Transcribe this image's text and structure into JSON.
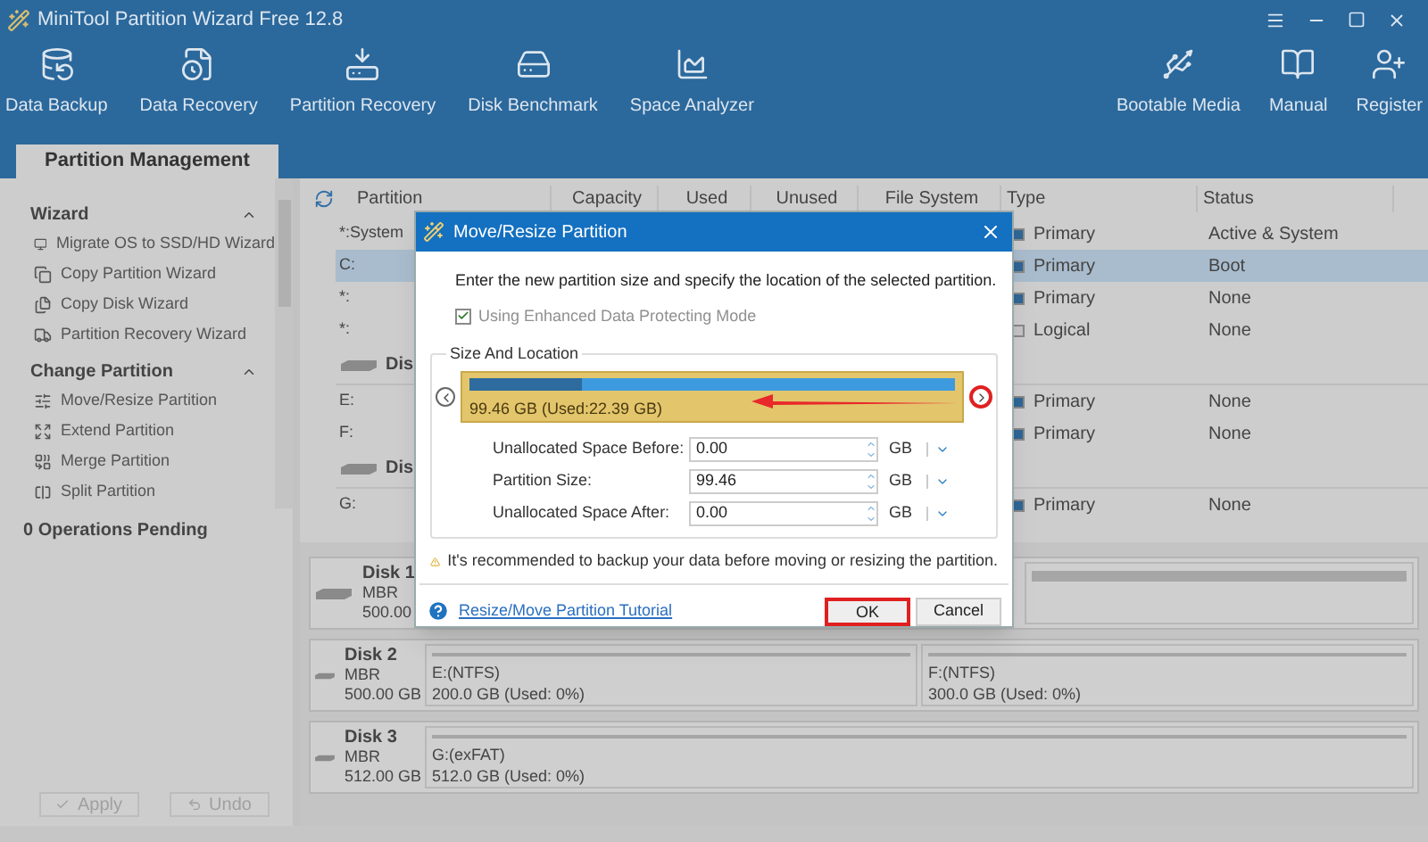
{
  "window": {
    "title": "MiniTool Partition Wizard Free 12.8"
  },
  "toolbar": {
    "left": [
      {
        "label": "Data Backup",
        "kind": "backup"
      },
      {
        "label": "Data Recovery",
        "kind": "recovery"
      },
      {
        "label": "Partition Recovery",
        "kind": "precovery"
      },
      {
        "label": "Disk Benchmark",
        "kind": "benchmark"
      },
      {
        "label": "Space Analyzer",
        "kind": "analyzer"
      }
    ],
    "right": [
      {
        "label": "Bootable Media",
        "kind": "usb"
      },
      {
        "label": "Manual",
        "kind": "book"
      },
      {
        "label": "Register",
        "kind": "user"
      }
    ]
  },
  "tabs": [
    {
      "label": "Partition Management",
      "selected": true
    }
  ],
  "sidebar": {
    "sections": [
      {
        "title": "Wizard",
        "expanded": true,
        "items": [
          {
            "label": "Migrate OS to SSD/HD Wizard",
            "kind": "migrate"
          },
          {
            "label": "Copy Partition Wizard",
            "kind": "copypart"
          },
          {
            "label": "Copy Disk Wizard",
            "kind": "copydisk"
          },
          {
            "label": "Partition Recovery Wizard",
            "kind": "precover"
          }
        ]
      },
      {
        "title": "Change Partition",
        "expanded": true,
        "items": [
          {
            "label": "Move/Resize Partition",
            "kind": "resize"
          },
          {
            "label": "Extend Partition",
            "kind": "extend"
          },
          {
            "label": "Merge Partition",
            "kind": "merge"
          },
          {
            "label": "Split Partition",
            "kind": "split"
          }
        ]
      }
    ],
    "pending": "0 Operations Pending",
    "buttons": [
      {
        "label": "Apply",
        "kind": "apply",
        "disabled": true
      },
      {
        "label": "Undo",
        "kind": "undo",
        "disabled": true
      }
    ]
  },
  "table": {
    "columns": [
      "Partition",
      "Capacity",
      "Used",
      "Unused",
      "File System",
      "Type",
      "Status"
    ],
    "rows": [
      {
        "kind": "partition",
        "partition": "*:System",
        "type": "Primary",
        "status": "Active & System",
        "color": "#2f6796",
        "selected": false
      },
      {
        "kind": "partition",
        "partition": "C:",
        "type": "Primary",
        "status": "Boot",
        "color": "#2f6796",
        "selected": true
      },
      {
        "kind": "partition",
        "partition": "*:",
        "type": "Primary",
        "status": "None",
        "color": "#2f6796",
        "selected": false
      },
      {
        "kind": "partition",
        "partition": "*:",
        "type": "Logical",
        "status": "None",
        "color": "#c4c4c4",
        "selected": false
      },
      {
        "kind": "disk",
        "partition": "Dis",
        "selected": false
      },
      {
        "kind": "partition",
        "partition": "E:",
        "type": "Primary",
        "status": "None",
        "color": "#2f6796",
        "selected": false
      },
      {
        "kind": "partition",
        "partition": "F:",
        "type": "Primary",
        "status": "None",
        "color": "#2f6796",
        "selected": false
      },
      {
        "kind": "disk",
        "partition": "Dis",
        "selected": false
      },
      {
        "kind": "partition",
        "partition": "G:",
        "type": "Primary",
        "status": "None",
        "color": "#2f6796",
        "selected": false
      }
    ]
  },
  "disk_map": [
    {
      "name": "Disk 1",
      "scheme": "MBR",
      "size": "500.00",
      "partitions": [
        {
          "kind": "hidden"
        }
      ]
    },
    {
      "name": "Disk 2",
      "scheme": "MBR",
      "size": "500.00 GB",
      "partitions": [
        {
          "label": "E:(NTFS)",
          "detail": "200.0 GB (Used: 0%)"
        },
        {
          "label": "F:(NTFS)",
          "detail": "300.0 GB (Used: 0%)"
        }
      ]
    },
    {
      "name": "Disk 3",
      "scheme": "MBR",
      "size": "512.00 GB",
      "partitions": [
        {
          "label": "G:(exFAT)",
          "detail": "512.0 GB (Used: 0%)"
        }
      ]
    }
  ],
  "dialog": {
    "title": "Move/Resize Partition",
    "instruction": "Enter the new partition size and specify the location of the selected partition.",
    "protect_mode": {
      "label": "Using Enhanced Data Protecting Mode",
      "checked": true,
      "disabled": true
    },
    "group_title": "Size And Location",
    "partition_bar": {
      "label": "99.46 GB (Used:22.39 GB)",
      "level": 0.23
    },
    "fields": [
      {
        "label": "Unallocated Space Before:",
        "value": "0.00",
        "unit": "GB"
      },
      {
        "label": "Partition Size:",
        "value": "99.46",
        "unit": "GB"
      },
      {
        "label": "Unallocated Space After:",
        "value": "0.00",
        "unit": "GB"
      }
    ],
    "warning": "It's recommended to backup your data before moving or resizing the partition.",
    "tutorial_link": "Resize/Move Partition Tutorial",
    "buttons": [
      {
        "label": "OK",
        "highlighted": true
      },
      {
        "label": "Cancel",
        "highlighted": false
      }
    ]
  }
}
